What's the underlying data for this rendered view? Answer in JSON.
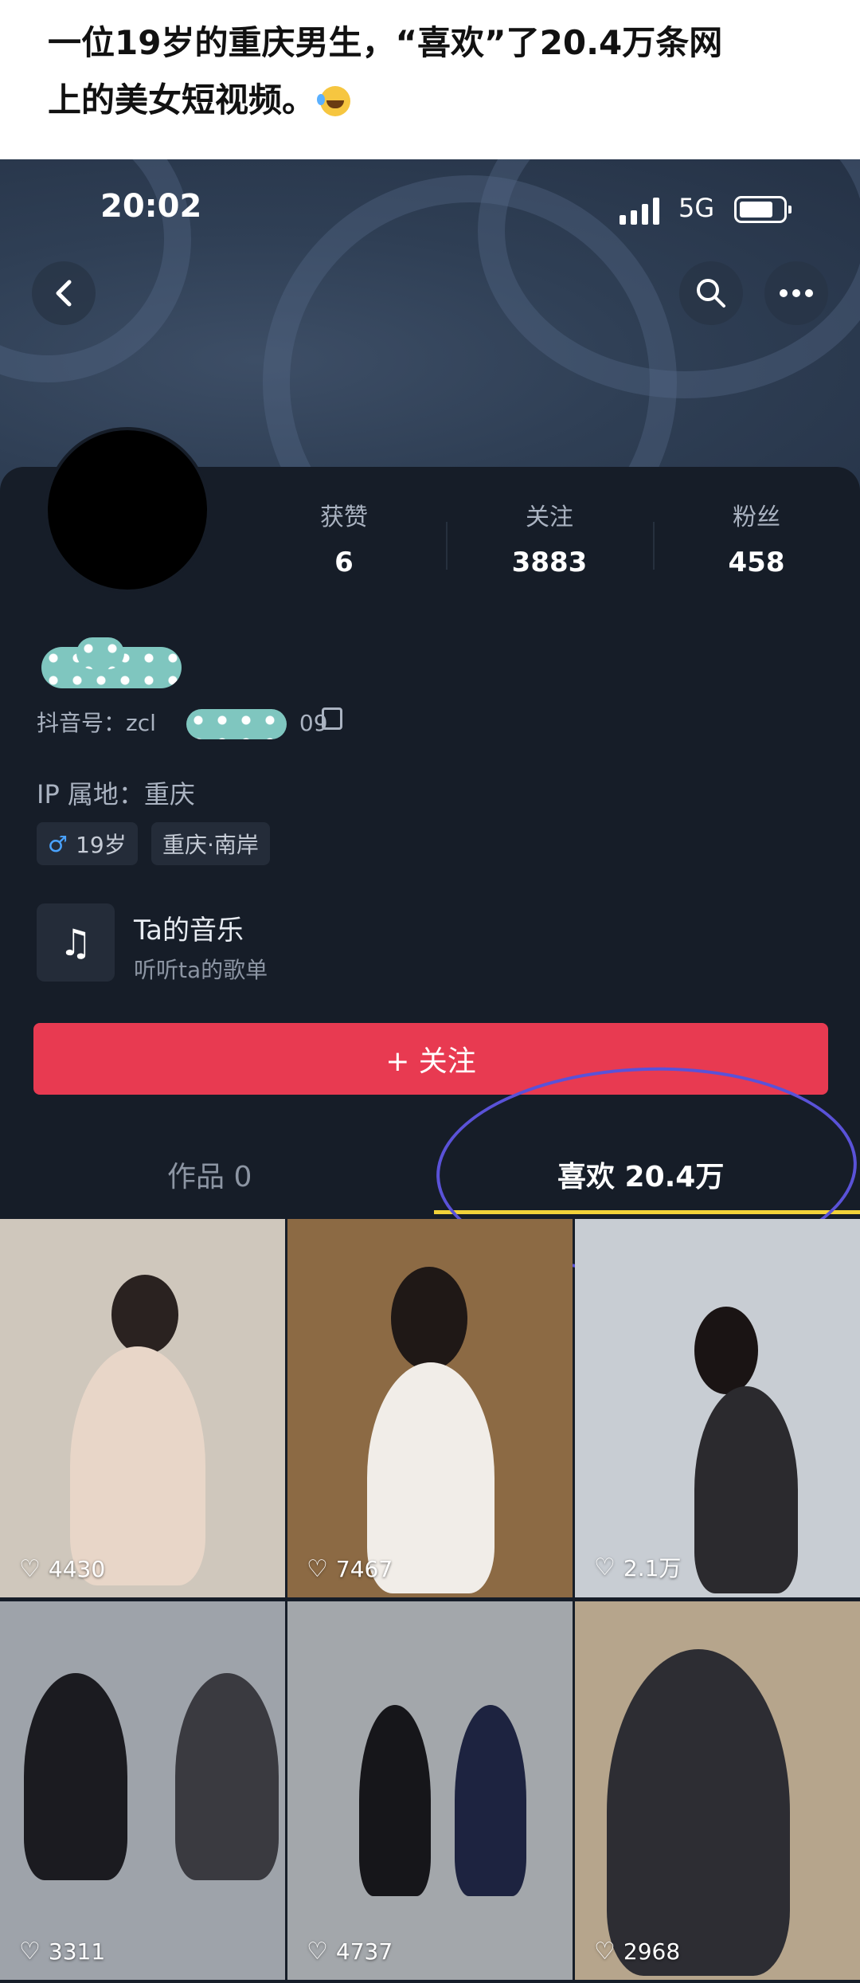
{
  "caption": {
    "line1": "一位19岁的重庆男生，“喜欢”了20.4万条网",
    "line2": "上的美女短视频。"
  },
  "status_bar": {
    "time": "20:02",
    "network": "5G"
  },
  "nav": {
    "back_icon": "back-arrow-icon",
    "search_icon": "search-icon",
    "more_icon": "more-icon"
  },
  "profile": {
    "stats": [
      {
        "label": "获赞",
        "value": "6"
      },
      {
        "label": "关注",
        "value": "3883"
      },
      {
        "label": "粉丝",
        "value": "458"
      }
    ],
    "douyin_id": "抖音号：zcl",
    "douyin_id_tail": "09",
    "ip_location": "IP 属地：重庆",
    "tags": [
      {
        "icon": "♂",
        "text": "19岁"
      },
      {
        "text": "重庆·南岸"
      }
    ]
  },
  "music": {
    "title": "Ta的音乐",
    "subtitle": "听听ta的歌单"
  },
  "follow_button": {
    "label": "+ 关注"
  },
  "tabs": [
    {
      "label": "作品 0"
    },
    {
      "label": "喜欢 20.4万"
    }
  ],
  "videos": [
    {
      "likes": "4430",
      "bg": "#cfc7bc"
    },
    {
      "likes": "7467",
      "bg": "#8c6a44"
    },
    {
      "likes": "2.1万",
      "bg": "#c8cdd3"
    },
    {
      "likes": "3311",
      "bg": "#9ea3aa"
    },
    {
      "likes": "4737",
      "bg": "#a3a7ab"
    },
    {
      "likes": "2968",
      "bg": "#b6a58c"
    }
  ],
  "colors": {
    "accent": "#e83a51",
    "tab_indicator": "#f2d23a",
    "annotation_circle": "#5a52d8",
    "background": "#161d28"
  }
}
